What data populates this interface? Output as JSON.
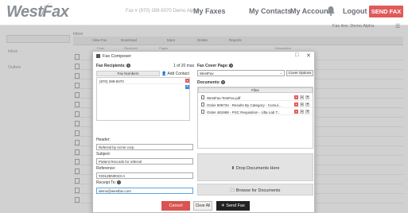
{
  "brand": {
    "logo": "WestFax"
  },
  "topnav": {
    "fax_number": "Fax #  (970) 289-5070 Demo Alpha",
    "my_faxes": "My Faxes",
    "my_contacts": "My Contacts",
    "my_account": "My Account",
    "logout": "Logout",
    "send_fax": "SEND FAX",
    "fax_line": "Fax line: Demo Alpha",
    "accent": "#e05a5a"
  },
  "background": {
    "section_title": "Inbox",
    "sidebar": [
      "Inbox",
      "Outbox"
    ],
    "toolbar": [
      "View Fax",
      "Download",
      "More",
      "Delete",
      "Reports"
    ],
    "columns": [
      "From",
      "Received",
      "Pages",
      "Description"
    ]
  },
  "modal": {
    "title": "Fax Composer",
    "recipients_label": "Fax Recipients:",
    "recipients_count": "1 of 20 max",
    "add_contact": "Add Contact",
    "fax_numbers_header": "Fax Numbers",
    "recipient": "(970) 289-5070",
    "cover_page_label": "Fax Cover Page:",
    "cover_page_value": "WestFax",
    "cover_options": "Cover Options",
    "documents_label": "Documents:",
    "files_header": "Files",
    "files": [
      "WestFax-TestFax.pdf",
      "Order 908734 - Results By Category - Cumul...",
      "Order 481958 - PSC Requisition - Ulta Lab T..."
    ],
    "header_label": "Header:",
    "header_value": "Referral by Acme corp",
    "subject_label": "Subject:",
    "subject_value": "Patient Records for referral",
    "reference_label": "Reference:",
    "reference_value": "#2012BN0023-A",
    "receipt_label": "Receipt To:",
    "receipt_value": "demo@westfax.com",
    "drop_documents": "Drop Documents Here",
    "browse_documents": "Browse for Documents",
    "cancel": "Cancel",
    "clear_all": "Clear All",
    "send_fax": "Send Fax"
  }
}
